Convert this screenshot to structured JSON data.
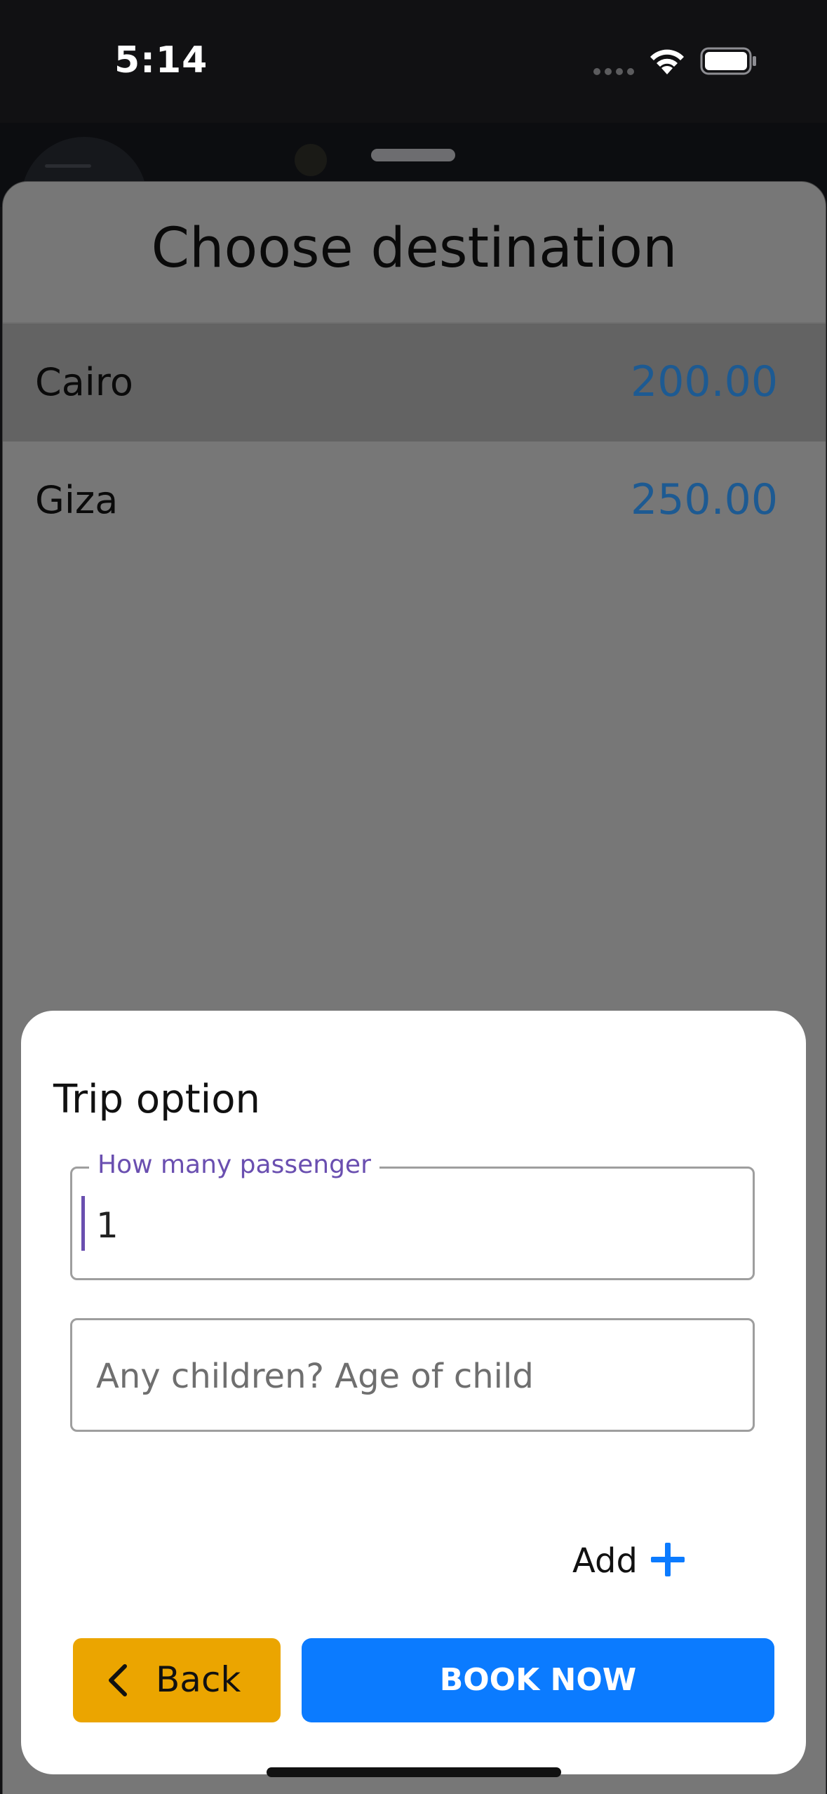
{
  "status_bar": {
    "time": "5:14"
  },
  "destination_sheet": {
    "title": "Choose destination",
    "destinations": [
      {
        "name": "Cairo",
        "price": "200.00",
        "selected": true
      },
      {
        "name": "Giza",
        "price": "250.00",
        "selected": false
      }
    ]
  },
  "trip_option": {
    "title": "Trip option",
    "passengers_field": {
      "label": "How many passenger",
      "value": "1"
    },
    "children_field": {
      "placeholder": "Any children? Age of child"
    },
    "add_label": "Add",
    "back_label": "Back",
    "book_label": "BOOK NOW"
  },
  "colors": {
    "accent_blue": "#0b7bff",
    "back_yellow": "#eba500",
    "price_blue": "#1d5a92",
    "label_purple": "#6a4fb0"
  }
}
